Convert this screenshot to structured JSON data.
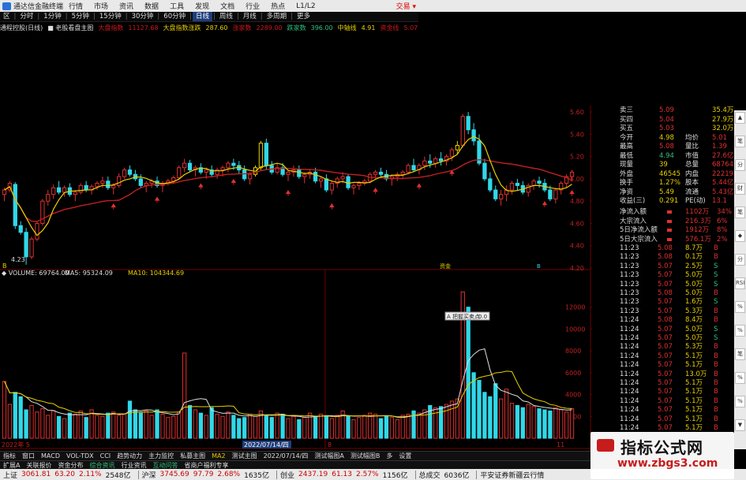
{
  "titlebar": {
    "app_title": "通达信金融终端",
    "menu": [
      "行情",
      "市场",
      "资讯",
      "数据",
      "工具",
      "发现",
      "文档",
      "行业",
      "热点",
      "L1/L2"
    ],
    "trade": "交易 ▾"
  },
  "toolbar": {
    "items": [
      "区",
      "|",
      "分时",
      "|",
      "1分钟",
      "|",
      "5分钟",
      "|",
      "15分钟",
      "|",
      "30分钟",
      "|",
      "60分钟",
      "|",
      "日线",
      "|",
      "周线",
      "|",
      "月线",
      "|",
      "多周期",
      "|",
      "更多"
    ],
    "active": "日线"
  },
  "infobar": {
    "items": [
      {
        "text": "通程控股(日线)",
        "color": "#dddddd"
      },
      {
        "text": "■ 老股看盘主图",
        "color": "#dddddd"
      },
      {
        "text": "大盘指数",
        "color": "#d01818"
      },
      {
        "text": "11127.68",
        "color": "#d01818"
      },
      {
        "text": "大盘指数涨跌",
        "color": "#e8d000"
      },
      {
        "text": "287.60",
        "color": "#e8d000"
      },
      {
        "text": "涨家数",
        "color": "#d01818"
      },
      {
        "text": "2289.00",
        "color": "#d01818"
      },
      {
        "text": "跌家数",
        "color": "#2ec27e"
      },
      {
        "text": "396.00",
        "color": "#2ec27e"
      },
      {
        "text": "中轴线",
        "color": "#e8d000"
      },
      {
        "text": "4.91",
        "color": "#e8d000"
      },
      {
        "text": "资金线",
        "color": "#d01818"
      },
      {
        "text": "5.07",
        "color": "#d01818"
      }
    ]
  },
  "price_axis": [
    "5.60",
    "5.40",
    "5.20",
    "5.00",
    "4.80",
    "4.60",
    "4.40",
    "4.20"
  ],
  "volume_axis": [
    "12000",
    "10000",
    "8000",
    "6000",
    "4000",
    "2000"
  ],
  "volume_legend": [
    {
      "text": "◆ VOLUME: 69764.00",
      "color": "#dddddd"
    },
    {
      "text": "MA5: 95324.09",
      "color": "#dddddd"
    },
    {
      "text": "MA10: 104344.69",
      "color": "#e8d000"
    }
  ],
  "chart_markers": {
    "low_price": "4.23",
    "buy_label": "B",
    "mid_label": "资金",
    "right_label": "B"
  },
  "popup": {
    "label": "A 把握买卖点",
    "value": "0.0"
  },
  "date_axis": {
    "left": "2022年 5",
    "highlight": "2022/07/14/四",
    "mark_right": "8",
    "mark_far": "11"
  },
  "quote_rows": [
    {
      "l1": "卖三",
      "v1": "5.09",
      "l2": "",
      "v2": "35.4万"
    },
    {
      "l1": "买四",
      "v1": "5.04",
      "l2": "",
      "v2": "27.9万"
    },
    {
      "l1": "买五",
      "v1": "5.03",
      "l2": "",
      "v2": "32.0万"
    },
    {
      "l1": "今开",
      "v1": "4.98",
      "l2": "均价",
      "v2": "5.01"
    },
    {
      "l1": "最高",
      "v1": "5.08",
      "l2": "量比",
      "v2": "1.39"
    },
    {
      "l1": "最低",
      "v1": "4.94",
      "l2": "市值",
      "v2": "27.6亿"
    },
    {
      "l1": "现量",
      "v1": "39",
      "l2": "总量",
      "v2": "68764"
    },
    {
      "l1": "外盘",
      "v1": "46545",
      "l2": "内盘",
      "v2": "22219"
    },
    {
      "l1": "换手",
      "v1": "1.27%",
      "l2": "股本",
      "v2": "5.44亿"
    },
    {
      "l1": "净资",
      "v1": "5.49",
      "l2": "流通",
      "v2": "5.43亿"
    },
    {
      "l1": "收益(三)",
      "v1": "0.291",
      "l2": "PE(动)",
      "v2": "13.1"
    }
  ],
  "flow_rows": [
    {
      "label": "净流入额",
      "value": "1102万",
      "pct": "34%"
    },
    {
      "label": "大宗流入",
      "value": "216.3万",
      "pct": "6%"
    },
    {
      "label": "5日净流入额",
      "value": "1912万",
      "pct": "8%"
    },
    {
      "label": "5日大宗流入",
      "value": "576.1万",
      "pct": "2%"
    }
  ],
  "ticks": [
    {
      "time": "11:23",
      "price": "5.08",
      "vol": "8.7万",
      "side": "B"
    },
    {
      "time": "11:23",
      "price": "5.08",
      "vol": "0.1万",
      "side": "B"
    },
    {
      "time": "11:23",
      "price": "5.07",
      "vol": "2.5万",
      "side": "S"
    },
    {
      "time": "11:23",
      "price": "5.07",
      "vol": "5.0万",
      "side": "S"
    },
    {
      "time": "11:23",
      "price": "5.07",
      "vol": "5.0万",
      "side": "S"
    },
    {
      "time": "11:23",
      "price": "5.08",
      "vol": "5.0万",
      "side": "B"
    },
    {
      "time": "11:23",
      "price": "5.07",
      "vol": "1.6万",
      "side": "S"
    },
    {
      "time": "11:23",
      "price": "5.07",
      "vol": "5.3万",
      "side": "B"
    },
    {
      "time": "11:24",
      "price": "5.08",
      "vol": "8.4万",
      "side": "B"
    },
    {
      "time": "11:24",
      "price": "5.07",
      "vol": "5.0万",
      "side": "S"
    },
    {
      "time": "11:24",
      "price": "5.07",
      "vol": "5.0万",
      "side": "S"
    },
    {
      "time": "11:24",
      "price": "5.07",
      "vol": "5.3万",
      "side": "B"
    },
    {
      "time": "11:24",
      "price": "5.07",
      "vol": "5.1万",
      "side": "B"
    },
    {
      "time": "11:24",
      "price": "5.07",
      "vol": "5.1万",
      "side": "B"
    },
    {
      "time": "11:24",
      "price": "5.07",
      "vol": "13.0万",
      "side": "B"
    },
    {
      "time": "11:24",
      "price": "5.07",
      "vol": "5.1万",
      "side": "B"
    },
    {
      "time": "11:24",
      "price": "5.07",
      "vol": "5.1万",
      "side": "B"
    },
    {
      "time": "11:24",
      "price": "5.07",
      "vol": "5.1万",
      "side": "B"
    },
    {
      "time": "11:24",
      "price": "5.07",
      "vol": "5.1万",
      "side": "B"
    },
    {
      "time": "11:24",
      "price": "5.07",
      "vol": "5.1万",
      "side": "B"
    },
    {
      "time": "11:24",
      "price": "5.07",
      "vol": "5.1万",
      "side": "B"
    }
  ],
  "tabs": {
    "items": [
      "指标",
      "窗口",
      "MACD",
      "VOL-TDX",
      "CCI",
      "趋势动力",
      "主力监控",
      "私募主图",
      "MA2",
      "测试主图",
      "2022/07/14/四",
      "测试幅图A",
      "测试幅图B",
      "多",
      "设置"
    ],
    "active": "MA2"
  },
  "subtabs": [
    "扩展A",
    "关联报价",
    "资金分布",
    "综合资讯",
    "行业资讯",
    "互动问答",
    "省商户福利专享"
  ],
  "statusbar": {
    "sh_label": "上证",
    "sh_val": "3061.81",
    "sh_chg": "63.20",
    "sh_pct": "2.11%",
    "sh_amt": "2548亿",
    "hs_label": "沪深",
    "hs_val": "3745.69",
    "hs_chg": "97.79",
    "hs_pct": "2.68%",
    "hs_amt": "1635亿",
    "cy_label": "创业",
    "cy_val": "2437.19",
    "cy_chg": "61.13",
    "cy_pct": "2.57%",
    "cy_amt": "1156亿",
    "total_label": "总成交",
    "total_val": "6036亿",
    "news": "平安证券新疆云行情"
  },
  "watermark": {
    "title": "指标公式网",
    "url": "www.zbgs3.com"
  },
  "scroll_labels": [
    "▲",
    "笔",
    "分",
    "财",
    "笔",
    "◆",
    "分",
    "RSI",
    "%",
    "%",
    "笔",
    "%",
    "%",
    "▼"
  ],
  "colors": {
    "up": "#e03030",
    "down": "#30d8e8",
    "ma_long": "#c02020",
    "ma_short": "#e8d000",
    "grid": "#700000"
  },
  "chart_data": {
    "type": "candlestick",
    "candles": [
      [
        4.86,
        4.92,
        4.8,
        4.9
      ],
      [
        4.9,
        4.98,
        4.88,
        4.96
      ],
      [
        4.95,
        4.97,
        4.55,
        4.58
      ],
      [
        4.58,
        4.62,
        4.5,
        4.52
      ],
      [
        4.52,
        4.56,
        4.23,
        4.3
      ],
      [
        4.3,
        4.48,
        4.28,
        4.46
      ],
      [
        4.46,
        4.62,
        4.44,
        4.6
      ],
      [
        4.6,
        4.82,
        4.58,
        4.8
      ],
      [
        4.8,
        4.9,
        4.76,
        4.86
      ],
      [
        4.86,
        4.95,
        4.82,
        4.92
      ],
      [
        4.92,
        4.98,
        4.86,
        4.88
      ],
      [
        4.88,
        4.94,
        4.84,
        4.92
      ],
      [
        4.92,
        4.96,
        4.84,
        4.86
      ],
      [
        4.86,
        4.9,
        4.8,
        4.88
      ],
      [
        4.88,
        4.96,
        4.86,
        4.94
      ],
      [
        4.94,
        4.98,
        4.88,
        4.9
      ],
      [
        4.9,
        4.95,
        4.86,
        4.93
      ],
      [
        4.93,
        4.98,
        4.9,
        4.96
      ],
      [
        4.96,
        5.02,
        4.92,
        4.98
      ],
      [
        4.98,
        5.02,
        4.9,
        4.92
      ],
      [
        4.92,
        4.96,
        4.86,
        4.94
      ],
      [
        4.94,
        5.05,
        4.92,
        5.02
      ],
      [
        5.02,
        5.1,
        5.0,
        5.08
      ],
      [
        5.08,
        5.12,
        5.02,
        5.04
      ],
      [
        5.04,
        5.08,
        4.98,
        5.0
      ],
      [
        5.0,
        5.04,
        4.92,
        4.94
      ],
      [
        4.94,
        4.98,
        4.88,
        4.96
      ],
      [
        4.96,
        5.0,
        4.92,
        4.98
      ],
      [
        4.98,
        5.02,
        4.92,
        4.94
      ],
      [
        4.94,
        4.98,
        4.88,
        4.96
      ],
      [
        4.96,
        5.0,
        4.94,
        4.98
      ],
      [
        4.98,
        5.03,
        4.96,
        5.01
      ],
      [
        5.01,
        5.12,
        4.99,
        5.1
      ],
      [
        5.1,
        5.18,
        5.06,
        5.14
      ],
      [
        5.14,
        5.17,
        5.06,
        5.08
      ],
      [
        5.08,
        5.12,
        5.02,
        5.1
      ],
      [
        5.1,
        5.14,
        5.04,
        5.06
      ],
      [
        5.06,
        5.1,
        5.0,
        5.08
      ],
      [
        5.08,
        5.12,
        5.02,
        5.04
      ],
      [
        5.04,
        5.1,
        5.0,
        5.08
      ],
      [
        5.08,
        5.12,
        5.02,
        5.1
      ],
      [
        5.1,
        5.16,
        5.06,
        5.14
      ],
      [
        5.14,
        5.18,
        5.08,
        5.12
      ],
      [
        5.12,
        5.16,
        5.04,
        5.08
      ],
      [
        5.08,
        5.12,
        4.98,
        5.0
      ],
      [
        5.0,
        5.06,
        4.95,
        5.04
      ],
      [
        5.04,
        5.12,
        5.02,
        5.1
      ],
      [
        5.1,
        5.34,
        5.08,
        5.32
      ],
      [
        5.32,
        5.36,
        5.08,
        5.12
      ],
      [
        5.12,
        5.16,
        5.04,
        5.06
      ],
      [
        5.06,
        5.14,
        5.04,
        5.1
      ],
      [
        5.1,
        5.14,
        5.02,
        5.04
      ],
      [
        5.04,
        5.08,
        4.98,
        5.06
      ],
      [
        5.06,
        5.12,
        5.02,
        5.08
      ],
      [
        5.08,
        5.12,
        5.0,
        5.02
      ],
      [
        5.02,
        5.06,
        4.96,
        5.04
      ],
      [
        5.04,
        5.08,
        5.0,
        5.06
      ],
      [
        5.06,
        5.1,
        4.96,
        4.98
      ],
      [
        4.98,
        5.02,
        4.92,
        5.0
      ],
      [
        5.0,
        5.04,
        4.88,
        4.9
      ],
      [
        4.9,
        4.98,
        4.86,
        4.96
      ],
      [
        4.96,
        5.02,
        4.92,
        5.0
      ],
      [
        5.0,
        5.06,
        4.96,
        5.02
      ],
      [
        5.02,
        5.04,
        4.9,
        4.92
      ],
      [
        4.92,
        4.96,
        4.86,
        4.94
      ],
      [
        4.94,
        4.98,
        4.9,
        4.96
      ],
      [
        4.96,
        5.0,
        4.94,
        4.98
      ],
      [
        4.98,
        5.06,
        4.96,
        5.04
      ],
      [
        5.04,
        5.08,
        5.0,
        5.06
      ],
      [
        5.06,
        5.1,
        5.02,
        5.04
      ],
      [
        5.04,
        5.08,
        4.98,
        5.0
      ],
      [
        5.0,
        5.04,
        4.94,
        5.02
      ],
      [
        5.02,
        5.06,
        4.98,
        5.04
      ],
      [
        5.04,
        5.08,
        5.0,
        5.06
      ],
      [
        5.06,
        5.14,
        5.04,
        5.12
      ],
      [
        5.12,
        5.18,
        5.06,
        5.08
      ],
      [
        5.08,
        5.14,
        5.04,
        5.12
      ],
      [
        5.12,
        5.2,
        5.08,
        5.16
      ],
      [
        5.16,
        5.22,
        5.1,
        5.14
      ],
      [
        5.14,
        5.2,
        5.1,
        5.18
      ],
      [
        5.18,
        5.24,
        5.12,
        5.16
      ],
      [
        5.16,
        5.22,
        5.12,
        5.2
      ],
      [
        5.2,
        5.28,
        5.16,
        5.26
      ],
      [
        5.26,
        5.34,
        5.22,
        5.3
      ],
      [
        5.3,
        5.58,
        5.28,
        5.56
      ],
      [
        5.56,
        5.6,
        5.4,
        5.44
      ],
      [
        5.44,
        5.5,
        5.3,
        5.34
      ],
      [
        5.34,
        5.4,
        5.12,
        5.14
      ],
      [
        5.14,
        5.18,
        4.98,
        5.0
      ],
      [
        5.0,
        5.06,
        4.88,
        4.9
      ],
      [
        4.9,
        4.94,
        4.8,
        4.82
      ],
      [
        4.82,
        4.9,
        4.76,
        4.86
      ],
      [
        4.86,
        4.94,
        4.8,
        4.9
      ],
      [
        4.9,
        4.98,
        4.86,
        4.96
      ],
      [
        4.96,
        5.0,
        4.9,
        4.94
      ],
      [
        4.94,
        4.98,
        4.86,
        4.88
      ],
      [
        4.88,
        4.96,
        4.84,
        4.94
      ],
      [
        4.94,
        5.0,
        4.9,
        4.98
      ],
      [
        4.98,
        5.02,
        4.92,
        4.96
      ],
      [
        4.96,
        5.0,
        4.88,
        4.9
      ],
      [
        4.9,
        4.94,
        4.8,
        4.82
      ],
      [
        4.82,
        4.92,
        4.78,
        4.9
      ],
      [
        4.9,
        4.98,
        4.86,
        4.96
      ],
      [
        4.96,
        5.04,
        4.92,
        5.02
      ],
      [
        5.02,
        5.08,
        4.98,
        5.06
      ]
    ],
    "volume": [
      5200,
      3100,
      4200,
      3800,
      2600,
      3000,
      2400,
      2700,
      2100,
      2500,
      2000,
      1800,
      2300,
      2200,
      2500,
      1900,
      2600,
      2100,
      2000,
      2300,
      2400,
      2100,
      2200,
      3400,
      2600,
      2300,
      2500,
      2100,
      2600,
      2200,
      1900,
      2000,
      2400,
      7800,
      3000,
      2600,
      2300,
      2100,
      2800,
      2200,
      2000,
      2400,
      2100,
      1800,
      1900,
      2200,
      2000,
      2500,
      2100,
      1900,
      2300,
      2200,
      1800,
      2000,
      1700,
      1900,
      2300,
      2000,
      2200,
      2000,
      1800,
      2100,
      2500,
      2000,
      1700,
      1900,
      2100,
      2300,
      2200,
      1800,
      2000,
      1900,
      1700,
      2100,
      2200,
      2500,
      2300,
      2600,
      3000,
      2800,
      2900,
      3100,
      3400,
      3600,
      13400,
      12000,
      6000,
      5300,
      4200,
      3800,
      5000,
      3600,
      4500,
      3200,
      3000,
      2800,
      3100,
      2900,
      2700,
      2600,
      2500,
      2800,
      2600,
      2400,
      2700
    ],
    "ylim": [
      4.2,
      5.65
    ],
    "vol_lim": [
      0,
      14000
    ]
  }
}
